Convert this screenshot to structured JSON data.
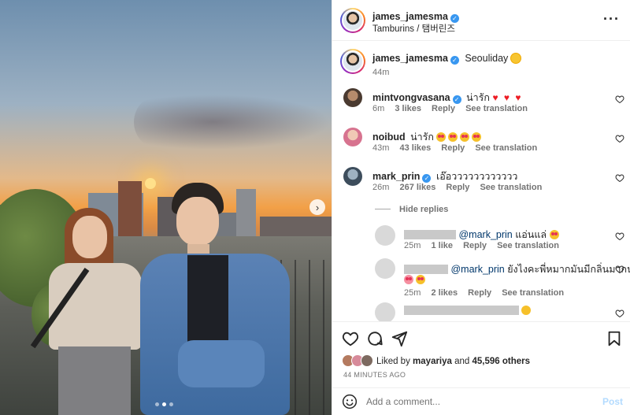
{
  "post": {
    "author": "james_jamesma",
    "location": "Tamburins / 탬버린즈",
    "caption_text": "Seouliday",
    "caption_time": "44m"
  },
  "comments": [
    {
      "user": "mintvongvasana",
      "verified": true,
      "text": "น่ารัก",
      "time": "6m",
      "likes": "3 likes",
      "reply": "Reply",
      "translate": "See translation"
    },
    {
      "user": "noibud",
      "verified": false,
      "text": "น่ารัก",
      "time": "43m",
      "likes": "43 likes",
      "reply": "Reply",
      "translate": "See translation"
    },
    {
      "user": "mark_prin",
      "verified": true,
      "text": "เอ๊อวววววววววววว",
      "time": "26m",
      "likes": "267 likes",
      "reply": "Reply",
      "translate": "See translation"
    }
  ],
  "hide_replies": "Hide replies",
  "replies": [
    {
      "mention": "@mark_prin",
      "text": "แอ่นแล่",
      "time": "25m",
      "likes": "1 like",
      "reply": "Reply",
      "translate": "See translation"
    },
    {
      "mention": "@mark_prin",
      "text": "ยังไงคะพี่หมากมันมีกลิ่นมากนะ",
      "time": "25m",
      "likes": "2 likes",
      "reply": "Reply",
      "translate": "See translation"
    },
    {
      "mention": "",
      "text": "",
      "time": "",
      "likes": "",
      "reply": "",
      "translate": ""
    }
  ],
  "likes_summary": {
    "prefix": "Liked by",
    "user": "mayariya",
    "joiner": "and",
    "others": "45,596 others"
  },
  "timestamp": "44 MINUTES AGO",
  "comment_input": {
    "placeholder": "Add a comment...",
    "post_label": "Post"
  },
  "colors": {
    "verified": "#3897f0",
    "link": "#00376b",
    "muted": "#737373",
    "post_disabled": "#b3dbff"
  },
  "carousel": {
    "slide_count": 3,
    "current": 2
  }
}
